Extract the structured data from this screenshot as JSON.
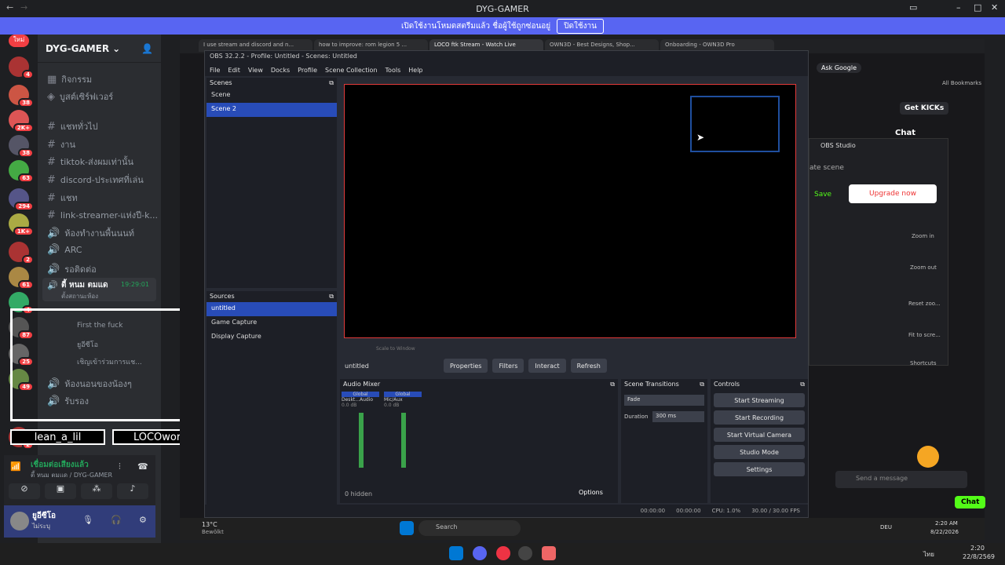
{
  "window_title": "DYG-GAMER",
  "banner": {
    "text": "เปิดใช้งานโหมดสตรีมแล้ว ชื่อผู้ใช้ถูกซ่อนอยู่",
    "button": "ปิดใช้งาน"
  },
  "tray_top": {
    "fps": "FPS",
    "lang": "ไม่เปลี่ยน"
  },
  "guild": {
    "name": "DYG-GAMER"
  },
  "channels": [
    {
      "icon": "calendar",
      "label": "กิจกรรม"
    },
    {
      "icon": "boost",
      "label": "บูสต์เซิร์ฟเวอร์"
    },
    {
      "icon": "hash",
      "label": "แชททั่วไป"
    },
    {
      "icon": "hash",
      "label": "งาน"
    },
    {
      "icon": "hash",
      "label": "tiktok-ส่งผมเท่านั้น"
    },
    {
      "icon": "hash",
      "label": "discord-ประเทศที่เล่น"
    },
    {
      "icon": "hash",
      "label": "แชท"
    },
    {
      "icon": "hash",
      "label": "link-streamer-แห่งปี-k..."
    },
    {
      "icon": "speaker",
      "label": "ห้องทำงานพื้นนนท์"
    },
    {
      "icon": "speaker",
      "label": "ARC"
    },
    {
      "icon": "speaker",
      "label": "รอติดต่อ"
    }
  ],
  "voice_channel": {
    "name": "ตี้ หนม ตมแด",
    "time": "19:29:01",
    "status": "ตั้งสถานะห้อง"
  },
  "voice_users": [
    "First the fuck",
    "ยูอีซีโอ",
    "เชิญเข้าร่วมการแช..."
  ],
  "more_channels": [
    "ห้องนอนของน้องๆ",
    "รับรอง"
  ],
  "overlay_names": [
    "lean_a_lil",
    "LOCOworld"
  ],
  "voice_panel": {
    "status": "เชื่อมต่อเสียงแล้ว",
    "channel": "ตี้ หนม ตมแด / DYG-GAMER"
  },
  "user": {
    "name": "ยูอีซีโอ",
    "status": "ไม่ระบุ"
  },
  "server_badges": [
    "4",
    "38",
    "2K+",
    "38",
    "63",
    "294",
    "1K+",
    "2",
    "61",
    "4",
    "87",
    "25",
    "49",
    "2"
  ],
  "browser_tabs": [
    "I use stream and discord and n...",
    "how to improve: rom legion 5 ...",
    "LOCO ftk Stream - Watch Live",
    "OWN3D - Best Designs, Shop...",
    "Onboarding - OWN3D Pro"
  ],
  "obs": {
    "title": "OBS 32.2.2 - Profile: Untitled - Scenes: Untitled",
    "menu": [
      "File",
      "Edit",
      "View",
      "Docks",
      "Profile",
      "Scene Collection",
      "Tools",
      "Help"
    ],
    "scenes_header": "Scenes",
    "scenes": [
      "Scene",
      "Scene 2"
    ],
    "sources_header": "Sources",
    "sources": [
      "untitled",
      "Game Capture",
      "Display Capture"
    ],
    "toolbar_source": "untitled",
    "toolbar_buttons": [
      "Properties",
      "Filters",
      "Interact",
      "Refresh"
    ],
    "zoom": "Scale to Window",
    "audio_header": "Audio Mixer",
    "audio_channels": [
      {
        "tag": "Global",
        "name": "Deskt...Audio",
        "db": "0.0 dB"
      },
      {
        "tag": "Global",
        "name": "Mic/Aux",
        "db": "0.0 dB"
      }
    ],
    "hidden": "0 hidden",
    "options": "Options",
    "transitions_header": "Scene Transitions",
    "transition": "Fade",
    "duration_label": "Duration",
    "duration": "300 ms",
    "controls_header": "Controls",
    "controls": [
      "Start Streaming",
      "Start Recording",
      "Start Virtual Camera",
      "Studio Mode",
      "Settings"
    ],
    "status": {
      "t1": "00:00:00",
      "t2": "00:00:00",
      "cpu": "CPU: 1.0%",
      "fps": "30.00 / 30.00 FPS"
    }
  },
  "browser_right": {
    "ask": "Ask Google",
    "bookmarks": "All Bookmarks",
    "get_kicks": "Get KICKs",
    "chat": "Chat",
    "studio": "OBS Studio",
    "scene": "ate scene",
    "save": "Save",
    "upgrade": "Upgrade now",
    "zoom_in": "Zoom in",
    "zoom_out": "Zoom out",
    "reset": "Reset zoo...",
    "fit": "Fit to scre...",
    "shortcuts": "Shortcuts",
    "send": "Send a message",
    "chat_btn": "Chat"
  },
  "taskbar": {
    "search": "Search",
    "weather": "13°C",
    "weather_desc": "Bewölkt",
    "lang": "DEU",
    "time": "2:20 AM",
    "date": "8/22/2026",
    "time2": "2:20",
    "date2": "22/8/2569",
    "lang2": "ไทย"
  }
}
